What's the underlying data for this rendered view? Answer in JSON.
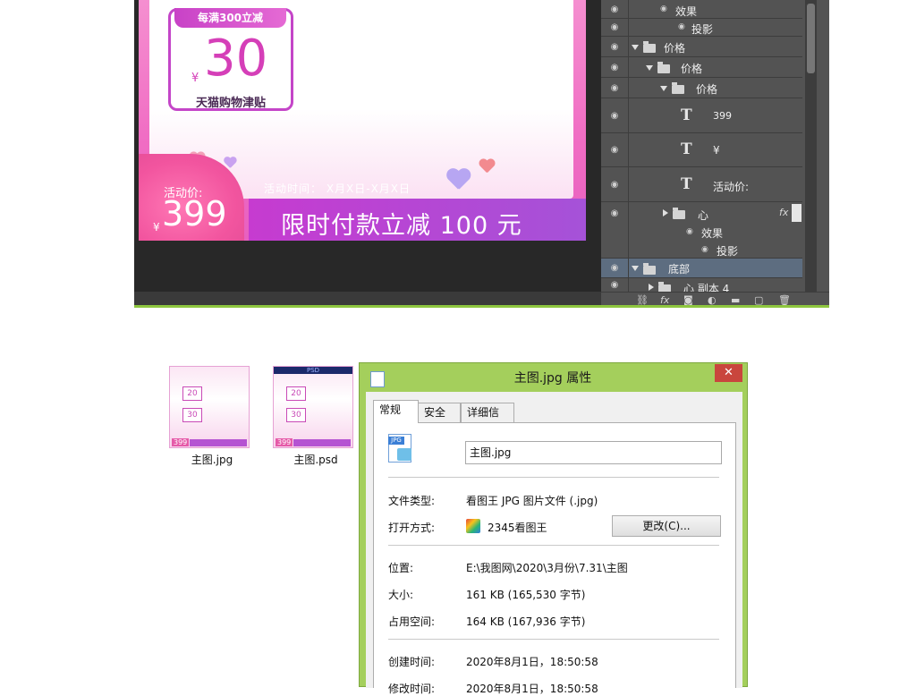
{
  "artboard": {
    "coupon_header": "每满300立减",
    "coupon_yen": "¥",
    "coupon_amount": "30",
    "coupon_footer": "天猫购物津贴",
    "promo_label": "活动价:",
    "promo_yen": "¥",
    "promo_price": "399",
    "promo_time": "活动时间：  X月X日-X月X日",
    "promo_banner": "限时付款立减 100 元"
  },
  "layers": {
    "rows": [
      {
        "label": "效果"
      },
      {
        "label": "投影"
      },
      {
        "label": "价格"
      },
      {
        "label": "价格"
      },
      {
        "label": "价格"
      },
      {
        "label": "399"
      },
      {
        "label": "¥"
      },
      {
        "label": "活动价:"
      },
      {
        "label": "心"
      },
      {
        "label": "效果"
      },
      {
        "label": "投影"
      },
      {
        "label": "底部"
      },
      {
        "label": "心 副本 4"
      }
    ],
    "fx_label": "fx"
  },
  "files": [
    {
      "name": "主图.jpg",
      "badge": "",
      "card1": "20",
      "card2": "30",
      "price": "399"
    },
    {
      "name": "主图.psd",
      "badge": "PSD",
      "card1": "20",
      "card2": "30",
      "price": "399"
    }
  ],
  "dialog": {
    "title": "主图.jpg 属性",
    "close": "✕",
    "tabs": [
      "常规",
      "安全",
      "详细信息"
    ],
    "file_name": "主图.jpg",
    "jpg_badge": "JPG",
    "props": {
      "type_label": "文件类型:",
      "type_value": "看图王 JPG 图片文件 (.jpg)",
      "open_label": "打开方式:",
      "open_value": "2345看图王",
      "change_button": "更改(C)...",
      "location_label": "位置:",
      "location_value": "E:\\我图网\\2020\\3月份\\7.31\\主图",
      "size_label": "大小:",
      "size_value": "161 KB (165,530 字节)",
      "disk_label": "占用空间:",
      "disk_value": "164 KB (167,936 字节)",
      "created_label": "创建时间:",
      "created_value": "2020年8月1日，18:50:58",
      "modified_label": "修改时间:",
      "modified_value": "2020年8月1日，18:50:58"
    }
  },
  "colors": {
    "ps_background": "#282828",
    "layers_panel": "#535353",
    "dialog_frame": "#a4cf5c",
    "accent_pink": "#f06cc3",
    "accent_purple": "#a552d8"
  }
}
